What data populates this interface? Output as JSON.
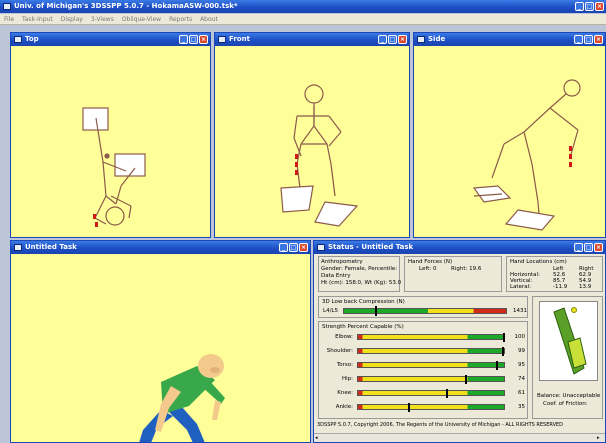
{
  "app": {
    "title": "Univ. of Michigan's 3DSSPP 5.0.7 - HokamaASW-000.tsk*"
  },
  "menu": [
    "File",
    "Task-Input",
    "Display",
    "3-Views",
    "Oblique-View",
    "Reports",
    "About"
  ],
  "panes": {
    "top": "Top",
    "front": "Front",
    "side": "Side",
    "oblique": "Untitled Task",
    "status": "Status - Untitled Task"
  },
  "status": {
    "anthro": {
      "title": "Anthropometry",
      "gender": "Gender: Female, Percentile:",
      "data": "Data Entry",
      "htwt": "Ht (cm): 158.0, Wt (Kg): 53.0"
    },
    "hand_forces": {
      "title": "Hand Forces (N)",
      "left": "Left: 0",
      "right": "Right: 19.6"
    },
    "hand_loc": {
      "title": "Hand Locations (cm)",
      "headers": [
        "Left",
        "Right"
      ],
      "rows": [
        {
          "label": "Horizontal:",
          "left": "52.6",
          "right": "62.9"
        },
        {
          "label": "Vertical:",
          "left": "85.7",
          "right": "54.9"
        },
        {
          "label": "Lateral:",
          "left": "-11.9",
          "right": "13.9"
        }
      ]
    },
    "compression": {
      "title": "3D Low back Compression (N)",
      "label": "L4/L5",
      "value": "1431",
      "marker": 0.2
    },
    "strength": {
      "title": "Strength Percent Capable (%)",
      "rows": [
        {
          "label": "Elbow:",
          "value": "100",
          "pct": 100
        },
        {
          "label": "Shoulder:",
          "value": "99",
          "pct": 99
        },
        {
          "label": "Torso:",
          "value": "95",
          "pct": 95
        },
        {
          "label": "Hip:",
          "value": "74",
          "pct": 74
        },
        {
          "label": "Knee:",
          "value": "61",
          "pct": 61
        },
        {
          "label": "Ankle:",
          "value": "35",
          "pct": 35
        }
      ]
    },
    "balance": "Balance: Unacceptable",
    "friction": "Coef. of Friction:",
    "copyright": "3DSSPP 5.0.7, Copyright 2006, The Regents of the University of Michigan - ALL RIGHTS RESERVED"
  },
  "colors": {
    "accent": "#1d4fc4",
    "viewport": "#ffff99",
    "figure_stick": "#8b5a4a",
    "skin": "#f3c98c",
    "shirt": "#39a84a",
    "pants": "#1f5fbf"
  }
}
